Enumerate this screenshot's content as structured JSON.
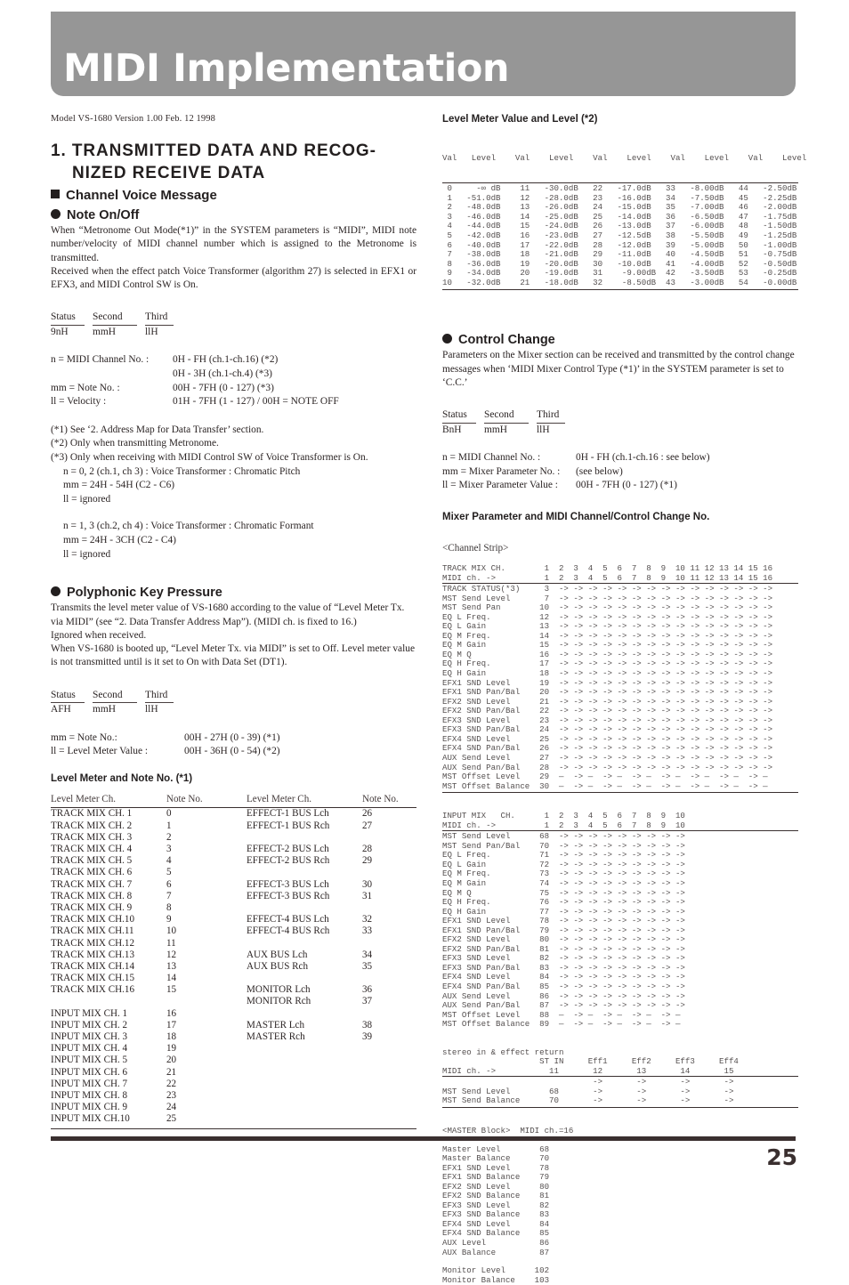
{
  "masthead": {
    "title": "MIDI Implementation"
  },
  "model_line": "Model VS-1680 Version 1.00 Feb. 12 1998",
  "footer": {
    "page_number": "25"
  },
  "left": {
    "section_heading_line1": "1. TRANSMITTED DATA AND RECOG-",
    "section_heading_line2": "NIZED RECEIVE DATA",
    "subheading": "Channel Voice Message",
    "note_on_off": {
      "title": "Note On/Off",
      "para1": "When “Metronome Out Mode(*1)” in the SYSTEM parameters is “MIDI”, MIDI note number/velocity of MIDI channel number which is assigned to the Metronome is transmitted.",
      "para2": "Received when the effect patch Voice Transformer (algorithm 27) is selected in EFX1 or EFX3, and MIDI Control SW is On.",
      "status_headers": {
        "status": "Status",
        "second": "Second",
        "third": "Third"
      },
      "status_values": {
        "status": "9nH",
        "second": "mmH",
        "third": "llH"
      },
      "defs": [
        {
          "label": "n = MIDI Channel No. :",
          "value": "0H - FH (ch.1-ch.16) (*2)"
        },
        {
          "label": "",
          "value": "0H - 3H (ch.1-ch.4) (*3)"
        },
        {
          "label": "mm = Note No. :",
          "value": "00H - 7FH (0 - 127) (*3)"
        },
        {
          "label": "ll = Velocity :",
          "value": "01H - 7FH (1 - 127) / 00H = NOTE OFF"
        }
      ],
      "notes": [
        "(*1) See ‘2. Address Map for Data Transfer’ section.",
        "(*2) Only when transmitting Metronome.",
        "(*3) Only when receiving with MIDI Control SW of Voice Transformer is On."
      ],
      "notes_indent_a": [
        "n = 0, 2 (ch.1, ch 3) : Voice Transformer : Chromatic Pitch",
        "mm = 24H - 54H (C2 - C6)",
        "ll = ignored"
      ],
      "notes_indent_b": [
        "n = 1, 3 (ch.2, ch 4) : Voice Transformer : Chromatic Formant",
        "mm = 24H - 3CH (C2 - C4)",
        "ll = ignored"
      ]
    },
    "poly_key_pressure": {
      "title": "Polyphonic Key Pressure",
      "para1": "Transmits the level meter value of VS-1680 according to the value of “Level Meter Tx. via MIDI” (see “2. Data Transfer Address Map”). (MIDI ch. is fixed to 16.)",
      "para2": "Ignored when received.",
      "para3": "When VS-1680 is booted up, “Level Meter Tx. via MIDI” is set to Off. Level meter value is not transmitted until is it set to On with Data Set (DT1).",
      "status_headers": {
        "status": "Status",
        "second": "Second",
        "third": "Third"
      },
      "status_values": {
        "status": "AFH",
        "second": "mmH",
        "third": "llH"
      },
      "defs": [
        {
          "label": "mm = Note No.:",
          "value": "00H - 27H (0 - 39)  (*1)"
        },
        {
          "label": "ll = Level Meter Value :",
          "value": "00H - 36H (0 - 54)  (*2)"
        }
      ]
    },
    "level_meter_note_table": {
      "title": "Level Meter and Note No.  (*1)",
      "headers": [
        "Level Meter Ch.",
        "Note No.",
        "Level Meter Ch.",
        "Note No."
      ],
      "rows": [
        [
          "TRACK MIX CH. 1",
          "0",
          "EFFECT-1 BUS Lch",
          "26"
        ],
        [
          "TRACK MIX CH. 2",
          "1",
          "EFFECT-1 BUS Rch",
          "27"
        ],
        [
          "TRACK MIX CH. 3",
          "2",
          "",
          ""
        ],
        [
          "TRACK MIX CH. 4",
          "3",
          "EFFECT-2 BUS Lch",
          "28"
        ],
        [
          "TRACK MIX CH. 5",
          "4",
          "EFFECT-2 BUS Rch",
          "29"
        ],
        [
          "TRACK MIX CH. 6",
          "5",
          "",
          ""
        ],
        [
          "TRACK MIX CH. 7",
          "6",
          "EFFECT-3 BUS Lch",
          "30"
        ],
        [
          "TRACK MIX CH. 8",
          "7",
          "EFFECT-3 BUS Rch",
          "31"
        ],
        [
          "TRACK MIX CH. 9",
          "8",
          "",
          ""
        ],
        [
          "TRACK MIX CH.10",
          "9",
          "EFFECT-4 BUS Lch",
          "32"
        ],
        [
          "TRACK MIX CH.11",
          "10",
          "EFFECT-4 BUS Rch",
          "33"
        ],
        [
          "TRACK MIX CH.12",
          "11",
          "",
          ""
        ],
        [
          "TRACK MIX CH.13",
          "12",
          "AUX BUS Lch",
          "34"
        ],
        [
          "TRACK MIX CH.14",
          "13",
          "AUX BUS Rch",
          "35"
        ],
        [
          "TRACK MIX CH.15",
          "14",
          "",
          ""
        ],
        [
          "TRACK MIX CH.16",
          "15",
          "MONITOR Lch",
          "36"
        ],
        [
          "",
          "",
          "MONITOR Rch",
          "37"
        ],
        [
          "INPUT MIX CH. 1",
          "16",
          "",
          ""
        ],
        [
          "INPUT MIX CH. 2",
          "17",
          "MASTER Lch",
          "38"
        ],
        [
          "INPUT MIX CH. 3",
          "18",
          "MASTER Rch",
          "39"
        ],
        [
          "INPUT MIX CH. 4",
          "19",
          "",
          ""
        ],
        [
          "INPUT MIX CH. 5",
          "20",
          "",
          ""
        ],
        [
          "INPUT MIX CH. 6",
          "21",
          "",
          ""
        ],
        [
          "INPUT MIX CH. 7",
          "22",
          "",
          ""
        ],
        [
          "INPUT MIX CH. 8",
          "23",
          "",
          ""
        ],
        [
          "INPUT MIX CH. 9",
          "24",
          "",
          ""
        ],
        [
          "INPUT MIX CH.10",
          "25",
          "",
          ""
        ]
      ]
    }
  },
  "right": {
    "level_value_table": {
      "title": "Level Meter Value and Level (*2)",
      "header_line": "Val   Level    Val    Level    Val    Level    Val    Level    Val    Level",
      "body": " 0     -∞ dB    11   -30.0dB   22   -17.0dB   33   -8.00dB   44   -2.50dB\n 1   -51.0dB    12   -28.0dB   23   -16.0dB   34   -7.50dB   45   -2.25dB\n 2   -48.0dB    13   -26.0dB   24   -15.0dB   35   -7.00dB   46   -2.00dB\n 3   -46.0dB    14   -25.0dB   25   -14.0dB   36   -6.50dB   47   -1.75dB\n 4   -44.0dB    15   -24.0dB   26   -13.0dB   37   -6.00dB   48   -1.50dB\n 5   -42.0dB    16   -23.0dB   27   -12.5dB   38   -5.50dB   49   -1.25dB\n 6   -40.0dB    17   -22.0dB   28   -12.0dB   39   -5.00dB   50   -1.00dB\n 7   -38.0dB    18   -21.0dB   29   -11.0dB   40   -4.50dB   51   -0.75dB\n 8   -36.0dB    19   -20.0dB   30   -10.0dB   41   -4.00dB   52   -0.50dB\n 9   -34.0dB    20   -19.0dB   31    -9.00dB  42   -3.50dB   53   -0.25dB\n10   -32.0dB    21   -18.0dB   32    -8.50dB  43   -3.00dB   54   -0.00dB"
    },
    "control_change": {
      "title": "Control Change",
      "para1": "Parameters on the Mixer section can be received and transmitted by the control change messages when ‘MIDI Mixer Control Type (*1)’ in the SYSTEM parameter is set to ‘C.C.’",
      "status_headers": {
        "status": "Status",
        "second": "Second",
        "third": "Third"
      },
      "status_values": {
        "status": "BnH",
        "second": "mmH",
        "third": "llH"
      },
      "defs": [
        {
          "label": "n = MIDI Channel No. :",
          "value": "0H - FH (ch.1-ch.16 : see below)"
        },
        {
          "label": "mm = Mixer Parameter No. :",
          "value": "(see below)"
        },
        {
          "label": "ll = Mixer Parameter Value :",
          "value": "00H - 7FH (0 - 127) (*1)"
        }
      ]
    },
    "mixer_param_title": "Mixer Parameter and MIDI Channel/Control Change No.",
    "channel_strip": {
      "label": "<Channel Strip>",
      "header": "TRACK MIX CH.        1  2  3  4  5  6  7  8  9  10 11 12 13 14 15 16\nMIDI ch. ->          1  2  3  4  5  6  7  8  9  10 11 12 13 14 15 16",
      "body": "TRACK STATUS(*3)     3  -> -> -> -> -> -> -> -> -> -> -> -> -> -> ->\nMST Send Level       7  -> -> -> -> -> -> -> -> -> -> -> -> -> -> ->\nMST Send Pan        10  -> -> -> -> -> -> -> -> -> -> -> -> -> -> ->\nEQ L Freq.          12  -> -> -> -> -> -> -> -> -> -> -> -> -> -> ->\nEQ L Gain           13  -> -> -> -> -> -> -> -> -> -> -> -> -> -> ->\nEQ M Freq.          14  -> -> -> -> -> -> -> -> -> -> -> -> -> -> ->\nEQ M Gain           15  -> -> -> -> -> -> -> -> -> -> -> -> -> -> ->\nEQ M Q              16  -> -> -> -> -> -> -> -> -> -> -> -> -> -> ->\nEQ H Freq.          17  -> -> -> -> -> -> -> -> -> -> -> -> -> -> ->\nEQ H Gain           18  -> -> -> -> -> -> -> -> -> -> -> -> -> -> ->\nEFX1 SND Level      19  -> -> -> -> -> -> -> -> -> -> -> -> -> -> ->\nEFX1 SND Pan/Bal    20  -> -> -> -> -> -> -> -> -> -> -> -> -> -> ->\nEFX2 SND Level      21  -> -> -> -> -> -> -> -> -> -> -> -> -> -> ->\nEFX2 SND Pan/Bal    22  -> -> -> -> -> -> -> -> -> -> -> -> -> -> ->\nEFX3 SND Level      23  -> -> -> -> -> -> -> -> -> -> -> -> -> -> ->\nEFX3 SND Pan/Bal    24  -> -> -> -> -> -> -> -> -> -> -> -> -> -> ->\nEFX4 SND Level      25  -> -> -> -> -> -> -> -> -> -> -> -> -> -> ->\nEFX4 SND Pan/Bal    26  -> -> -> -> -> -> -> -> -> -> -> -> -> -> ->\nAUX Send Level      27  -> -> -> -> -> -> -> -> -> -> -> -> -> -> ->\nAUX Send Pan/Bal    28  -> -> -> -> -> -> -> -> -> -> -> -> -> -> ->\nMST Offset Level    29  —  -> —  -> —  -> —  -> —  -> —  -> —  -> —\nMST Offset Balance  30  —  -> —  -> —  -> —  -> —  -> —  -> —  -> —"
    },
    "input_mix": {
      "header": "INPUT MIX   CH.      1  2  3  4  5  6  7  8  9  10\nMIDI ch. ->          1  2  3  4  5  6  7  8  9  10",
      "body": "MST Send Level      68  -> -> -> -> -> -> -> -> ->\nMST Send Pan/Bal    70  -> -> -> -> -> -> -> -> ->\nEQ L Freq.          71  -> -> -> -> -> -> -> -> ->\nEQ L Gain           72  -> -> -> -> -> -> -> -> ->\nEQ M Freq.          73  -> -> -> -> -> -> -> -> ->\nEQ M Gain           74  -> -> -> -> -> -> -> -> ->\nEQ M Q              75  -> -> -> -> -> -> -> -> ->\nEQ H Freq.          76  -> -> -> -> -> -> -> -> ->\nEQ H Gain           77  -> -> -> -> -> -> -> -> ->\nEFX1 SND Level      78  -> -> -> -> -> -> -> -> ->\nEFX1 SND Pan/Bal    79  -> -> -> -> -> -> -> -> ->\nEFX2 SND Level      80  -> -> -> -> -> -> -> -> ->\nEFX2 SND Pan/Bal    81  -> -> -> -> -> -> -> -> ->\nEFX3 SND Level      82  -> -> -> -> -> -> -> -> ->\nEFX3 SND Pan/Bal    83  -> -> -> -> -> -> -> -> ->\nEFX4 SND Level      84  -> -> -> -> -> -> -> -> ->\nEFX4 SND Pan/Bal    85  -> -> -> -> -> -> -> -> ->\nAUX Send Level      86  -> -> -> -> -> -> -> -> ->\nAUX Send Pan/Bal    87  -> -> -> -> -> -> -> -> ->\nMST Offset Level    88  —  -> —  -> —  -> —  -> —\nMST Offset Balance  89  —  -> —  -> —  -> —  -> —"
    },
    "stereo_in": {
      "label": "stereo in & effect return",
      "header": "                    ST IN     Eff1     Eff2     Eff3     Eff4\nMIDI ch. ->           11       12       13       14       15",
      "body": "                               ->       ->       ->       ->\nMST Send Level        68       ->       ->       ->       ->\nMST Send Balance      70       ->       ->       ->       ->"
    },
    "master_block": {
      "label": "<MASTER Block>  MIDI ch.=16",
      "body": "Master Level        68\nMaster Balance      70\nEFX1 SND Level      78\nEFX1 SND Balance    79\nEFX2 SND Level      80\nEFX2 SND Balance    81\nEFX3 SND Level      82\nEFX3 SND Balance    83\nEFX4 SND Level      84\nEFX4 SND Balance    85\nAUX Level           86\nAUX Balance         87",
      "body2": "Monitor Level      102\nMonitor Balance    103"
    }
  }
}
